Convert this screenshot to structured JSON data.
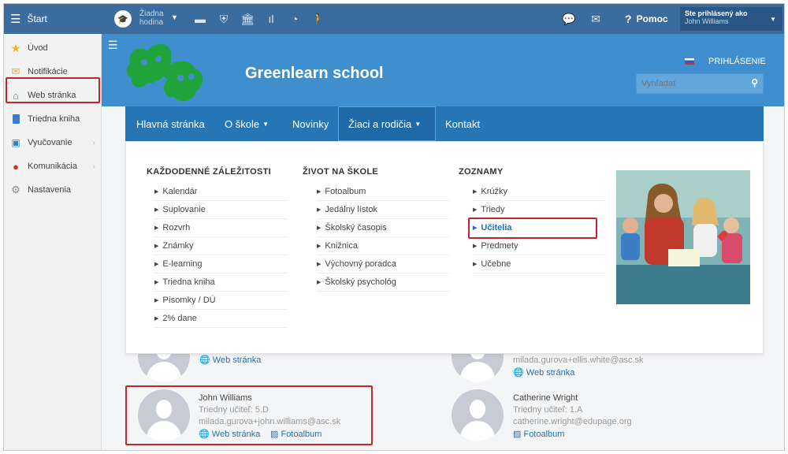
{
  "topbar": {
    "start_label": "Štart",
    "lesson_label": "Žiadna hodina",
    "help_label": "Pomoc",
    "login_status": "Ste prihlásený ako",
    "user_name": "John Williams"
  },
  "sidebar": {
    "items": [
      {
        "label": "Úvod",
        "icon": "star-icon"
      },
      {
        "label": "Notifikácie",
        "icon": "envelope-icon"
      },
      {
        "label": "Web stránka",
        "icon": "home-icon"
      },
      {
        "label": "Triedna kniha",
        "icon": "book-icon"
      },
      {
        "label": "Vyučovanie",
        "icon": "classroom-icon"
      },
      {
        "label": "Komunikácia",
        "icon": "chat-icon"
      },
      {
        "label": "Nastavenia",
        "icon": "gear-icon"
      }
    ]
  },
  "site": {
    "school_name": "Greenlearn school",
    "login_link": "PRIHLÁSENIE",
    "search_placeholder": "Vyhľadať",
    "nav": [
      "Hlavná stránka",
      "O škole",
      "Novinky",
      "Žiaci a rodičia",
      "Kontakt"
    ]
  },
  "megamenu": {
    "columns": [
      {
        "title": "KAŽDODENNÉ ZÁLEŽITOSTI",
        "items": [
          "Kalendár",
          "Suplovanie",
          "Rozvrh",
          "Známky",
          "E-learning",
          "Triedna kniha",
          "Písomky / DÚ",
          "2% dane"
        ]
      },
      {
        "title": "ŽIVOT NA ŠKOLE",
        "items": [
          "Fotoalbum",
          "Jedálny lístok",
          "Školský časopis",
          "Knižnica",
          "Výchovný poradca",
          "Školský psychológ"
        ]
      },
      {
        "title": "ZOZNAMY",
        "items": [
          "Krúžky",
          "Triedy",
          "Učitelia",
          "Predmety",
          "Učebne"
        ]
      }
    ]
  },
  "teachers": {
    "partial_left_link": "Web stránka",
    "partial_right_email": "milada.gurova+ellis.white@asc.sk",
    "partial_right_link": "Web stránka",
    "cards": [
      {
        "name": "John Williams",
        "role": "Triedny učiteľ: 5.D",
        "email": "milada.gurova+john.williams@asc.sk",
        "web": "Web stránka",
        "album": "Fotoalbum"
      },
      {
        "name": "Catherine Wright",
        "role": "Triedny učiteľ: 1.A",
        "email": "catherine.wright@edupage.org",
        "album": "Fotoalbum"
      }
    ]
  },
  "colors": {
    "topbar": "#3b6c9e",
    "header": "#3f8fcf",
    "nav": "#2676b6",
    "highlight": "#c0272d"
  }
}
